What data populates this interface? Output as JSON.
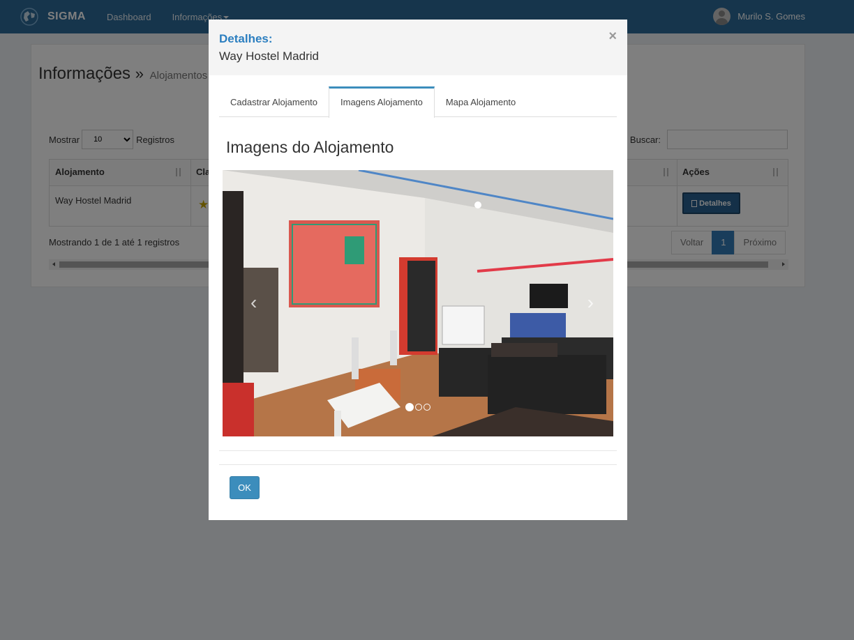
{
  "navbar": {
    "brand": "SIGMA",
    "links": [
      "Dashboard",
      "Informações"
    ],
    "user_name": "Murilo S. Gomes"
  },
  "page": {
    "title": "Informações",
    "subtitle": "Alojamentos",
    "show_label": "Mostrar",
    "show_value": "10",
    "records_label": "Registros",
    "search_label": "Buscar:",
    "search_value": "",
    "columns": [
      "Alojamento",
      "Cla",
      "Ações"
    ],
    "rows": [
      {
        "alojamento": "Way Hostel Madrid",
        "rating_stars": 1,
        "action": "Detalhes"
      }
    ],
    "info": "Mostrando 1 de 1 até 1 registros",
    "pager": {
      "prev": "Voltar",
      "current": "1",
      "next": "Próximo"
    }
  },
  "modal": {
    "kicker": "Detalhes:",
    "title": "Way Hostel Madrid",
    "close": "×",
    "tabs": [
      "Cadastrar Alojamento",
      "Imagens Alojamento",
      "Mapa Alojamento"
    ],
    "active_tab": 1,
    "section_title": "Imagens do Alojamento",
    "carousel": {
      "count": 3,
      "active": 0,
      "prev": "‹",
      "next": "›"
    },
    "ok_label": "OK"
  },
  "colors": {
    "navbar": "#2c6a98",
    "primary": "#337ab7",
    "modal_accent": "#2c7fc0"
  }
}
